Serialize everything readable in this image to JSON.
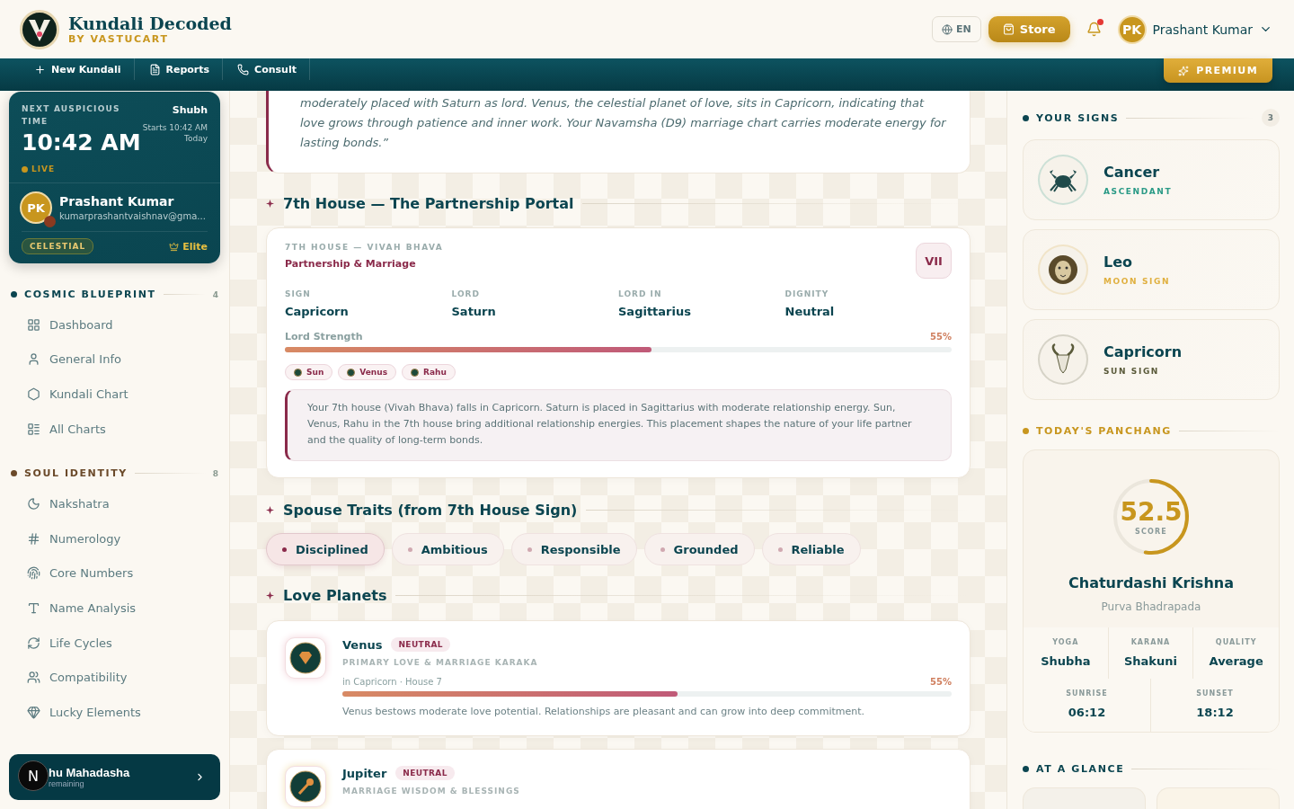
{
  "brand": {
    "title": "Kundali Decoded",
    "subtitle": "BY VASTUCART"
  },
  "header": {
    "language": "EN",
    "store": "Store",
    "notifications_unread": true,
    "user": {
      "initials": "PK",
      "name": "Prashant Kumar"
    }
  },
  "navbar": {
    "items": [
      {
        "kind": "plus",
        "label": "New Kundali"
      },
      {
        "kind": "file",
        "label": "Reports"
      },
      {
        "kind": "phone",
        "label": "Consult"
      }
    ],
    "premium": "PREMIUM"
  },
  "auspicious": {
    "label": "NEXT AUSPICIOUS TIME",
    "time": "10:42 AM",
    "live": "LIVE",
    "name": "Shubh",
    "starts": "Starts 10:42 AM",
    "day": "Today"
  },
  "profile": {
    "initials": "PK",
    "name": "Prashant Kumar",
    "email": "kumarprashantvaishnav@gma...",
    "tier": "CELESTIAL",
    "plan": "Elite"
  },
  "sidebar": [
    {
      "title": "COSMIC BLUEPRINT",
      "count": "4",
      "color": "#0b4550",
      "items": [
        {
          "kind": "grid",
          "label": "Dashboard",
          "selected": false
        },
        {
          "kind": "user",
          "label": "General Info",
          "selected": false
        },
        {
          "kind": "hexagon",
          "label": "Kundali Chart",
          "selected": false
        },
        {
          "kind": "list",
          "label": "All Charts",
          "selected": false
        }
      ]
    },
    {
      "title": "SOUL IDENTITY",
      "count": "8",
      "color": "#6b4a2a",
      "items": [
        {
          "kind": "moon",
          "label": "Nakshatra",
          "selected": false
        },
        {
          "kind": "hash",
          "label": "Numerology",
          "selected": false
        },
        {
          "kind": "fingerprint",
          "label": "Core Numbers",
          "selected": false
        },
        {
          "kind": "type",
          "label": "Name Analysis",
          "selected": false
        },
        {
          "kind": "cycle",
          "label": "Life Cycles",
          "selected": false
        },
        {
          "kind": "users",
          "label": "Compatibility",
          "selected": false
        },
        {
          "kind": "gem",
          "label": "Lucky Elements",
          "selected": false
        }
      ]
    }
  ],
  "mahadasha": {
    "title": "hu Mahadasha",
    "subtitle": "remaining"
  },
  "dev_badge": "N",
  "quote": "moderately placed with Saturn as lord. Venus, the celestial planet of love, sits in Capricorn, indicating that love grows through patience and inner work. Your Navamsha (D9) marriage chart carries moderate energy for lasting bonds.”",
  "house_section": {
    "heading": "7th House — The Partnership Portal",
    "eyebrow": "7TH HOUSE — VIVAH BHAVA",
    "title": "Partnership & Marriage",
    "numeral": "VII",
    "facts": [
      {
        "label": "SIGN",
        "value": "Capricorn"
      },
      {
        "label": "LORD",
        "value": "Saturn"
      },
      {
        "label": "LORD IN",
        "value": "Sagittarius"
      },
      {
        "label": "DIGNITY",
        "value": "Neutral"
      }
    ],
    "strength": {
      "label": "Lord Strength",
      "reading": "55%",
      "level": 0.55
    },
    "planets": [
      "Sun",
      "Venus",
      "Rahu"
    ],
    "note": "Your 7th house (Vivah Bhava) falls in Capricorn. Saturn is placed in Sagittarius with moderate relationship energy. Sun, Venus, Rahu in the 7th house bring additional relationship energies. This placement shapes the nature of your life partner and the quality of long-term bonds."
  },
  "traits_section": {
    "heading": "Spouse Traits (from 7th House Sign)",
    "traits": [
      {
        "label": "Disciplined",
        "selected": true
      },
      {
        "label": "Ambitious",
        "selected": false
      },
      {
        "label": "Responsible",
        "selected": false
      },
      {
        "label": "Grounded",
        "selected": false
      },
      {
        "label": "Reliable",
        "selected": false
      }
    ]
  },
  "planets_section": {
    "heading": "Love Planets",
    "planets": [
      {
        "kind": "gem",
        "name": "Venus",
        "dignity": "NEUTRAL",
        "role": "PRIMARY LOVE & MARRIAGE KARAKA",
        "placement": "in Capricorn · House 7",
        "reading": "55%",
        "level": 0.55,
        "description": "Venus bestows moderate love potential. Relationships are pleasant and can grow into deep commitment."
      },
      {
        "kind": "wand",
        "name": "Jupiter",
        "dignity": "NEUTRAL",
        "role": "MARRIAGE WISDOM & BLESSINGS"
      }
    ]
  },
  "signs": {
    "title": "YOUR SIGNS",
    "count": "3",
    "items": [
      {
        "kind": "crab",
        "name": "Cancer",
        "role": "ASCENDANT",
        "color": "#2a9a86"
      },
      {
        "kind": "lion",
        "name": "Leo",
        "role": "MOON SIGN",
        "color": "#e0b040"
      },
      {
        "kind": "goat",
        "name": "Capricorn",
        "role": "SUN SIGN",
        "color": "#5a5a3a"
      }
    ]
  },
  "panchang": {
    "title": "TODAY'S PANCHANG",
    "score": "52.5",
    "score_label": "SCORE",
    "level": 0.525,
    "tithi": "Chaturdashi Krishna",
    "nakshatra": "Purva Bhadrapada",
    "stats": [
      {
        "label": "YOGA",
        "value": "Shubha"
      },
      {
        "label": "KARANA",
        "value": "Shakuni"
      },
      {
        "label": "QUALITY",
        "value": "Average"
      }
    ],
    "times": [
      {
        "label": "SUNRISE",
        "value": "06:12"
      },
      {
        "label": "SUNSET",
        "value": "18:12"
      }
    ]
  },
  "glance": {
    "title": "AT A GLANCE"
  }
}
